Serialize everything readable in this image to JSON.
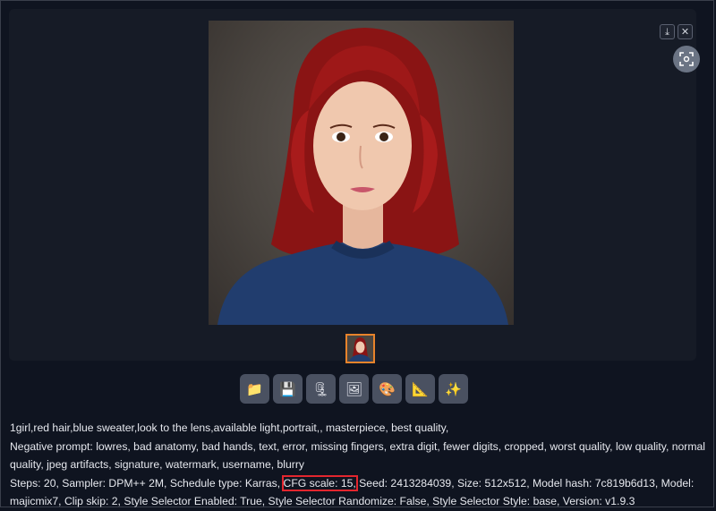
{
  "window": {
    "download_label": "⤓",
    "close_label": "✕"
  },
  "thumbnail": {
    "selected_index": 1,
    "count": 1
  },
  "toolbar": [
    {
      "name": "open-folder-button",
      "glyph": "📁"
    },
    {
      "name": "save-button",
      "glyph": "💾"
    },
    {
      "name": "zip-button",
      "glyph": "🗜"
    },
    {
      "name": "send-to-img2img-button",
      "glyph": "🖼"
    },
    {
      "name": "send-to-inpaint-button",
      "glyph": "🎨"
    },
    {
      "name": "send-to-extras-button",
      "glyph": "📐"
    },
    {
      "name": "send-to-tools-button",
      "glyph": "✨"
    }
  ],
  "generation_info": {
    "prompt": "1girl,red hair,blue sweater,look to the lens,available light,portrait,, masterpiece, best quality,",
    "negative_prompt": "Negative prompt: lowres, bad anatomy, bad hands, text, error, missing fingers, extra digit, fewer digits, cropped, worst quality, low quality, normal quality, jpeg artifacts, signature, watermark, username, blurry",
    "params_before": "Steps: 20, Sampler: DPM++ 2M, Schedule type: Karras, ",
    "params_highlight": "CFG scale: 15,",
    "params_after": " Seed: 2413284039, Size: 512x512, Model hash: 7c819b6d13, Model: majicmix7, Clip skip: 2, Style Selector Enabled: True, Style Selector Randomize: False, Style Selector Style: base, Version: v1.9.3"
  },
  "colors": {
    "background": "#0f1420",
    "panel": "#161b26",
    "button": "#4a5161",
    "thumbnail_border": "#e8832b",
    "highlight": "#e3262e"
  }
}
